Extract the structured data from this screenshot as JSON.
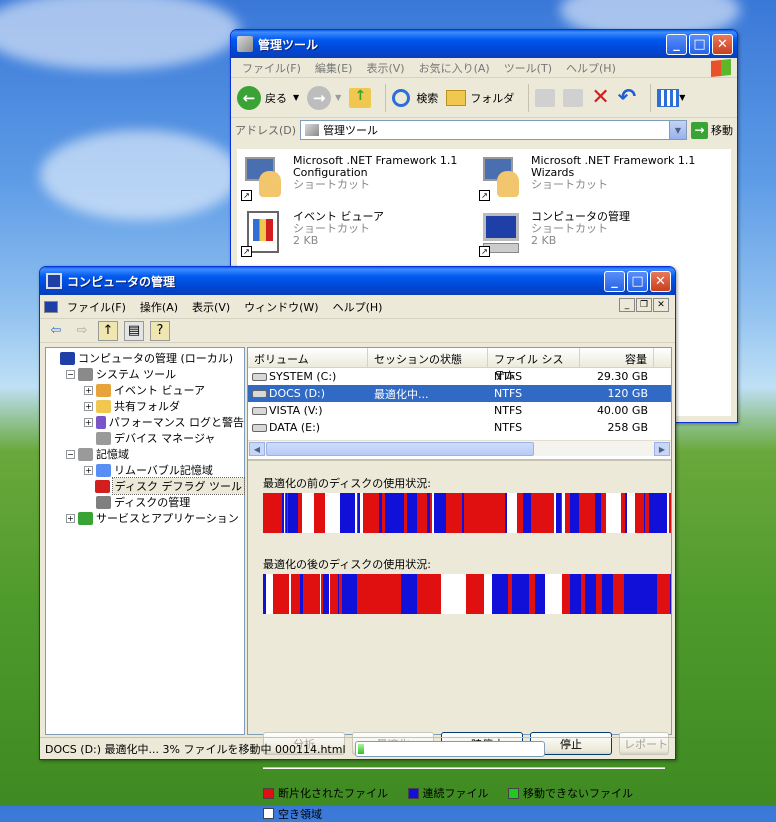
{
  "admin_window": {
    "title": "管理ツール",
    "menu": [
      "ファイル(F)",
      "編集(E)",
      "表示(V)",
      "お気に入り(A)",
      "ツール(T)",
      "ヘルプ(H)"
    ],
    "toolbar": {
      "back": "戻る",
      "search": "検索",
      "folders": "フォルダ"
    },
    "address": {
      "label": "アドレス(D)",
      "value": "管理ツール",
      "go": "移動"
    },
    "shortcuts": [
      {
        "name1": "Microsoft .NET Framework 1.1",
        "name2": "Configuration",
        "type": "ショートカット",
        "size": ""
      },
      {
        "name1": "Microsoft .NET Framework 1.1",
        "name2": "Wizards",
        "type": "ショートカット",
        "size": ""
      },
      {
        "name1": "イベント ビューア",
        "name2": "",
        "type": "ショートカット",
        "size": "2 KB"
      },
      {
        "name1": "コンピュータの管理",
        "name2": "",
        "type": "ショートカット",
        "size": "2 KB"
      }
    ]
  },
  "comp_window": {
    "title": "コンピュータの管理",
    "menu": [
      "ファイル(F)",
      "操作(A)",
      "表示(V)",
      "ウィンドウ(W)",
      "ヘルプ(H)"
    ],
    "tree": [
      {
        "label": "コンピュータの管理 (ローカル)",
        "level": 0,
        "exp": ""
      },
      {
        "label": "システム ツール",
        "level": 1,
        "exp": "−"
      },
      {
        "label": "イベント ビューア",
        "level": 2,
        "exp": "+"
      },
      {
        "label": "共有フォルダ",
        "level": 2,
        "exp": "+"
      },
      {
        "label": "パフォーマンス ログと警告",
        "level": 2,
        "exp": "+"
      },
      {
        "label": "デバイス マネージャ",
        "level": 2,
        "exp": ""
      },
      {
        "label": "記憶域",
        "level": 1,
        "exp": "−"
      },
      {
        "label": "リムーバブル記憶域",
        "level": 2,
        "exp": "+"
      },
      {
        "label": "ディスク デフラグ ツール",
        "level": 2,
        "exp": "",
        "selected": true
      },
      {
        "label": "ディスクの管理",
        "level": 2,
        "exp": ""
      },
      {
        "label": "サービスとアプリケーション",
        "level": 1,
        "exp": "+"
      }
    ],
    "columns": [
      "ボリューム",
      "セッションの状態",
      "ファイル システム",
      "容量"
    ],
    "volumes": [
      {
        "name": "SYSTEM (C:)",
        "state": "",
        "fs": "NTFS",
        "size": "29.30 GB"
      },
      {
        "name": "DOCS (D:)",
        "state": "最適化中...",
        "fs": "NTFS",
        "size": "120 GB",
        "selected": true
      },
      {
        "name": "VISTA (V:)",
        "state": "",
        "fs": "NTFS",
        "size": "40.00 GB"
      },
      {
        "name": "DATA (E:)",
        "state": "",
        "fs": "NTFS",
        "size": "258 GB"
      }
    ],
    "before_label": "最適化の前のディスクの使用状況:",
    "after_label": "最適化の後のディスクの使用状況:",
    "buttons": [
      {
        "label": "分析",
        "enabled": false
      },
      {
        "label": "最適化",
        "enabled": false
      },
      {
        "label": "一時停止",
        "enabled": true
      },
      {
        "label": "停止",
        "enabled": true
      },
      {
        "label": "レポートの表示",
        "enabled": false
      }
    ],
    "legend": [
      {
        "label": "断片化されたファイル",
        "color": "#e01010"
      },
      {
        "label": "連続ファイル",
        "color": "#1010d8"
      },
      {
        "label": "移動できないファイル",
        "color": "#20c820"
      },
      {
        "label": "空き領域",
        "color": "#ffffff"
      }
    ],
    "status": "DOCS (D:) 最適化中... 3%  ファイルを移動中 000114.html",
    "progress_pct": 3
  }
}
